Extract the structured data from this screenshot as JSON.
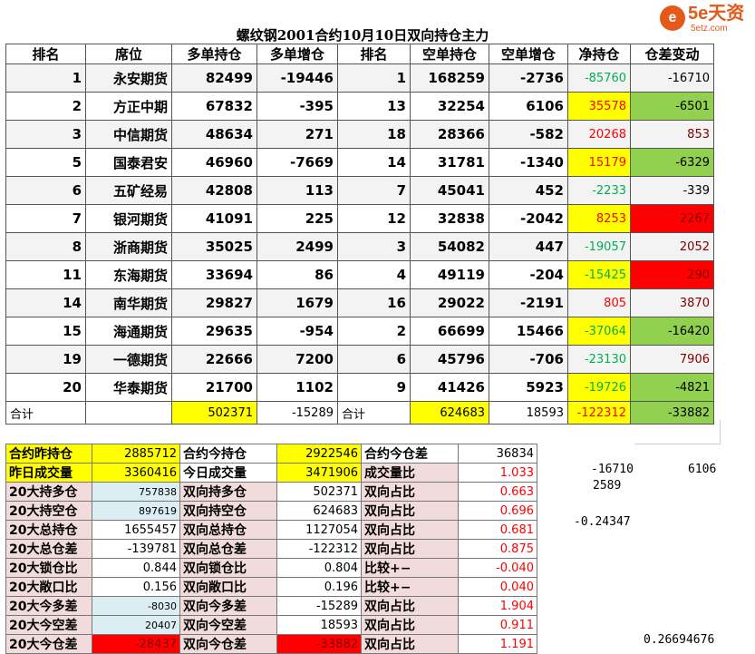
{
  "title": "螺纹钢2001合约10月10日双向持仓主力",
  "logo": {
    "badge": "e",
    "brand": "5e天资",
    "sub": "5etz.com"
  },
  "headers": [
    "排名",
    "席位",
    "多单持仓",
    "多单增仓",
    "排名",
    "空单持仓",
    "空单增仓",
    "净持仓",
    "仓差变动"
  ],
  "rows": [
    {
      "rank": "1",
      "name": "永安期货",
      "long": "82499",
      "long_chg": "-19446",
      "srank": "1",
      "short": "168259",
      "short_chg": "-2736",
      "net": "-85760",
      "diff": "-16710",
      "net_sign": "neg",
      "diff_sign": "gr"
    },
    {
      "rank": "2",
      "name": "方正中期",
      "long": "67832",
      "long_chg": "-395",
      "srank": "13",
      "short": "32254",
      "short_chg": "6106",
      "net": "35578",
      "diff": "-6501",
      "net_sign": "pos",
      "diff_sign": "gr"
    },
    {
      "rank": "3",
      "name": "中信期货",
      "long": "48634",
      "long_chg": "271",
      "srank": "18",
      "short": "28366",
      "short_chg": "-582",
      "net": "20268",
      "diff": "853",
      "net_sign": "pos",
      "diff_sign": "rd"
    },
    {
      "rank": "5",
      "name": "国泰君安",
      "long": "46960",
      "long_chg": "-7669",
      "srank": "14",
      "short": "31781",
      "short_chg": "-1340",
      "net": "15179",
      "diff": "-6329",
      "net_sign": "pos",
      "diff_sign": "gr"
    },
    {
      "rank": "6",
      "name": "五矿经易",
      "long": "42808",
      "long_chg": "113",
      "srank": "7",
      "short": "45041",
      "short_chg": "452",
      "net": "-2233",
      "diff": "-339",
      "net_sign": "neg",
      "diff_sign": "gr"
    },
    {
      "rank": "7",
      "name": "银河期货",
      "long": "41091",
      "long_chg": "225",
      "srank": "12",
      "short": "32838",
      "short_chg": "-2042",
      "net": "8253",
      "diff": "2267",
      "net_sign": "pos",
      "diff_sign": "rd"
    },
    {
      "rank": "8",
      "name": "浙商期货",
      "long": "35025",
      "long_chg": "2499",
      "srank": "3",
      "short": "54082",
      "short_chg": "447",
      "net": "-19057",
      "diff": "2052",
      "net_sign": "neg",
      "diff_sign": "rd"
    },
    {
      "rank": "11",
      "name": "东海期货",
      "long": "33694",
      "long_chg": "86",
      "srank": "4",
      "short": "49119",
      "short_chg": "-204",
      "net": "-15425",
      "diff": "290",
      "net_sign": "neg",
      "diff_sign": "rd"
    },
    {
      "rank": "14",
      "name": "南华期货",
      "long": "29827",
      "long_chg": "1679",
      "srank": "16",
      "short": "29022",
      "short_chg": "-2191",
      "net": "805",
      "diff": "3870",
      "net_sign": "pos",
      "diff_sign": "rd"
    },
    {
      "rank": "15",
      "name": "海通期货",
      "long": "29635",
      "long_chg": "-954",
      "srank": "2",
      "short": "66699",
      "short_chg": "15466",
      "net": "-37064",
      "diff": "-16420",
      "net_sign": "neg",
      "diff_sign": "gr"
    },
    {
      "rank": "19",
      "name": "一德期货",
      "long": "22666",
      "long_chg": "7200",
      "srank": "6",
      "short": "45796",
      "short_chg": "-706",
      "net": "-23130",
      "diff": "7906",
      "net_sign": "neg",
      "diff_sign": "rd"
    },
    {
      "rank": "20",
      "name": "华泰期货",
      "long": "21700",
      "long_chg": "1102",
      "srank": "9",
      "short": "41426",
      "short_chg": "5923",
      "net": "-19726",
      "diff": "-4821",
      "net_sign": "neg",
      "diff_sign": "gr"
    }
  ],
  "total": {
    "label": "合计",
    "long": "502371",
    "long_chg": "-15289",
    "label2": "合计",
    "short": "624683",
    "short_chg": "18593",
    "net": "-122312",
    "diff": "-33882"
  },
  "summary": [
    {
      "l1": "合约昨持仓",
      "v1": "2885712",
      "l2": "合约今持仓",
      "v2": "2922546",
      "l3": "合约今仓差",
      "v3": "36834"
    },
    {
      "l1": "昨日成交量",
      "v1": "3360416",
      "l2": "今日成交量",
      "v2": "3471906",
      "l3": "成交量比",
      "v3": "1.033"
    },
    {
      "l1": "20大持多仓",
      "v1": "757838",
      "l2": "双向持多仓",
      "v2": "502371",
      "l3": "双向占比",
      "v3": "0.663"
    },
    {
      "l1": "20大持空仓",
      "v1": "897619",
      "l2": "双向持空仓",
      "v2": "624683",
      "l3": "双向占比",
      "v3": "0.696"
    },
    {
      "l1": "20大总持仓",
      "v1": "1655457",
      "l2": "双向总持仓",
      "v2": "1127054",
      "l3": "双向占比",
      "v3": "0.681"
    },
    {
      "l1": "20大总仓差",
      "v1": "-139781",
      "l2": "双向总仓差",
      "v2": "-122312",
      "l3": "双向占比",
      "v3": "0.875"
    },
    {
      "l1": "20大锁仓比",
      "v1": "0.844",
      "l2": "双向锁仓比",
      "v2": "0.804",
      "l3": "比较+−",
      "v3": "-0.040"
    },
    {
      "l1": "20大敞口比",
      "v1": "0.156",
      "l2": "双向敞口比",
      "v2": "0.196",
      "l3": "比较+−",
      "v3": "0.040"
    },
    {
      "l1": "20大今多差",
      "v1": "-8030",
      "l2": "双向今多差",
      "v2": "-15289",
      "l3": "双向占比",
      "v3": "1.904"
    },
    {
      "l1": "20大今空差",
      "v1": "20407",
      "l2": "双向今空差",
      "v2": "18593",
      "l3": "双向占比",
      "v3": "0.911"
    },
    {
      "l1": "20大今仓差",
      "v1": "-28437",
      "l2": "双向今仓差",
      "v2": "-33882",
      "l3": "双向占比",
      "v3": "1.191"
    }
  ],
  "side": {
    "a1": "-16710",
    "a2": "6106",
    "a3": "2589",
    "a4": "-0.24347",
    "a5": "0.26694676"
  }
}
